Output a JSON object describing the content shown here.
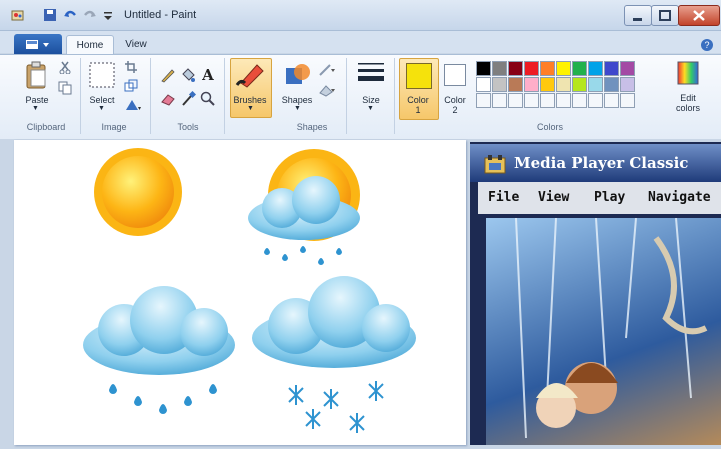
{
  "window": {
    "title": "Untitled - Paint"
  },
  "tabs": [
    {
      "label": "Home"
    },
    {
      "label": "View"
    }
  ],
  "ribbon": {
    "clipboard": {
      "paste_label": "Paste",
      "group_label": "Clipboard"
    },
    "image": {
      "select_label": "Select",
      "group_label": "Image"
    },
    "tools": {
      "group_label": "Tools"
    },
    "brushes": {
      "label": "Brushes"
    },
    "shapes": {
      "label": "Shapes",
      "group_label": "Shapes"
    },
    "size": {
      "label": "Size"
    },
    "color1": {
      "label": "Color",
      "num": "1"
    },
    "color2": {
      "label": "Color",
      "num": "2"
    },
    "colors": {
      "group_label": "Colors"
    },
    "edit_colors": {
      "line1": "Edit",
      "line2": "colors"
    }
  },
  "palette": {
    "row1": [
      "#000000",
      "#7f7f7f",
      "#880015",
      "#ed1c24",
      "#ff7f27",
      "#fff200",
      "#22b14c",
      "#00a2e8",
      "#3f48cc",
      "#a349a4"
    ],
    "row2": [
      "#ffffff",
      "#c3c3c3",
      "#b97a57",
      "#ffaec9",
      "#ffc90e",
      "#efe4b0",
      "#b5e61d",
      "#99d9ea",
      "#7092be",
      "#c8bfe7"
    ]
  },
  "color1_value": "#f5e20c",
  "media_player": {
    "title": "Media Player Classic",
    "menu": [
      "File",
      "View",
      "Play",
      "Navigate"
    ]
  }
}
